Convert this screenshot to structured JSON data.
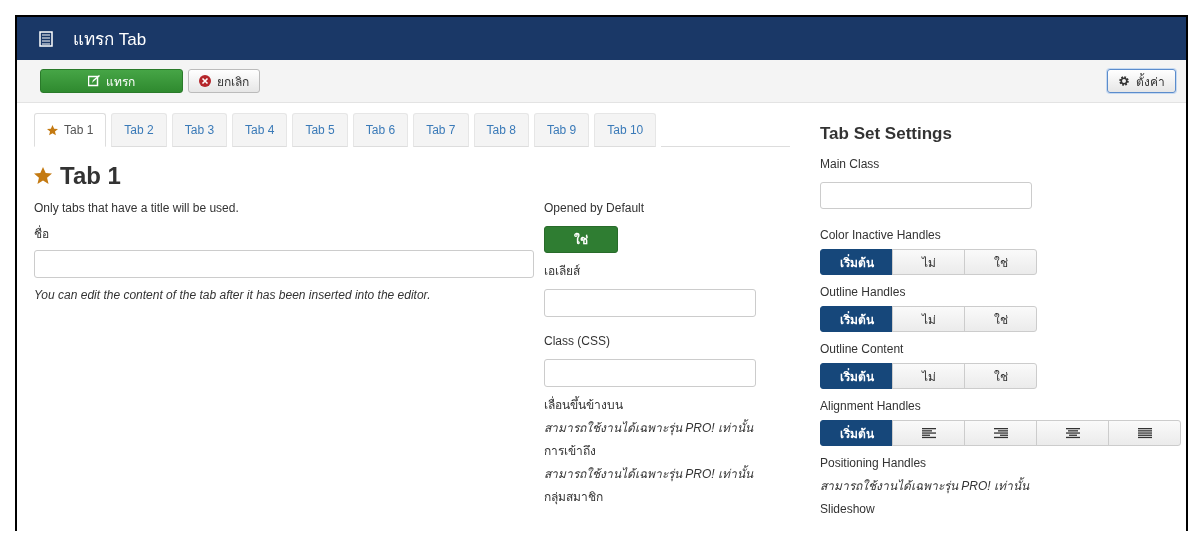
{
  "header": {
    "title": "แทรก Tab"
  },
  "toolbar": {
    "buttons": [
      {
        "label": "แทรก",
        "kind": "insert"
      },
      {
        "label": "ยกเลิก",
        "kind": "cancel"
      }
    ],
    "settings_button": "ตั้งค่า"
  },
  "tabs": [
    {
      "label": "Tab 1",
      "selected": true
    },
    {
      "label": "Tab 2",
      "selected": false
    },
    {
      "label": "Tab 3",
      "selected": false
    },
    {
      "label": "Tab 4",
      "selected": false
    },
    {
      "label": "Tab 5",
      "selected": false
    },
    {
      "label": "Tab 6",
      "selected": false
    },
    {
      "label": "Tab 7",
      "selected": false
    },
    {
      "label": "Tab 8",
      "selected": false
    },
    {
      "label": "Tab 9",
      "selected": false
    },
    {
      "label": "Tab 10",
      "selected": false
    }
  ],
  "tab_panel": {
    "heading": "Tab 1",
    "note": "Only tabs that have a title will be used.",
    "name_label": "ชื่อ",
    "help": "You can edit the content of the tab after it has been inserted into the editor."
  },
  "tab_options": {
    "opened_label": "Opened by Default",
    "opened_toggle": {
      "label": "ใช่",
      "on": true
    },
    "alias_label": "เอเลียส์",
    "class_label": "Class (CSS)",
    "pro_items": [
      {
        "label": "เลื่อนขึ้นข้างบน",
        "note": "สามารถใช้งานได้เฉพาะรุ่น PRO! เท่านั้น"
      },
      {
        "label": "การเข้าถึง",
        "note": "สามารถใช้งานได้เฉพาะรุ่น PRO! เท่านั้น"
      },
      {
        "label": "กลุ่มสมาชิก"
      }
    ]
  },
  "settings": {
    "title": "Tab Set Settings",
    "main_class_label": "Main Class",
    "groups": [
      {
        "label": "Color Inactive Handles",
        "options": [
          {
            "kind": "text",
            "label": "เริ่มต้น",
            "selected": true
          },
          {
            "kind": "text",
            "label": "ไม่",
            "selected": false
          },
          {
            "kind": "text",
            "label": "ใช่",
            "selected": false
          }
        ]
      },
      {
        "label": "Outline Handles",
        "options": [
          {
            "kind": "text",
            "label": "เริ่มต้น",
            "selected": true
          },
          {
            "kind": "text",
            "label": "ไม่",
            "selected": false
          },
          {
            "kind": "text",
            "label": "ใช่",
            "selected": false
          }
        ]
      },
      {
        "label": "Outline Content",
        "options": [
          {
            "kind": "text",
            "label": "เริ่มต้น",
            "selected": true
          },
          {
            "kind": "text",
            "label": "ไม่",
            "selected": false
          },
          {
            "kind": "text",
            "label": "ใช่",
            "selected": false
          }
        ]
      },
      {
        "label": "Alignment Handles",
        "options": [
          {
            "kind": "text",
            "label": "เริ่มต้น",
            "selected": true
          },
          {
            "kind": "align-left",
            "selected": false
          },
          {
            "kind": "align-right",
            "selected": false
          },
          {
            "kind": "align-center",
            "selected": false
          },
          {
            "kind": "justify",
            "selected": false
          }
        ]
      }
    ],
    "positioning_label": "Positioning Handles",
    "positioning_note": "สามารถใช้งานได้เฉพาะรุ่น PRO! เท่านั้น",
    "slideshow_label": "Slideshow"
  }
}
